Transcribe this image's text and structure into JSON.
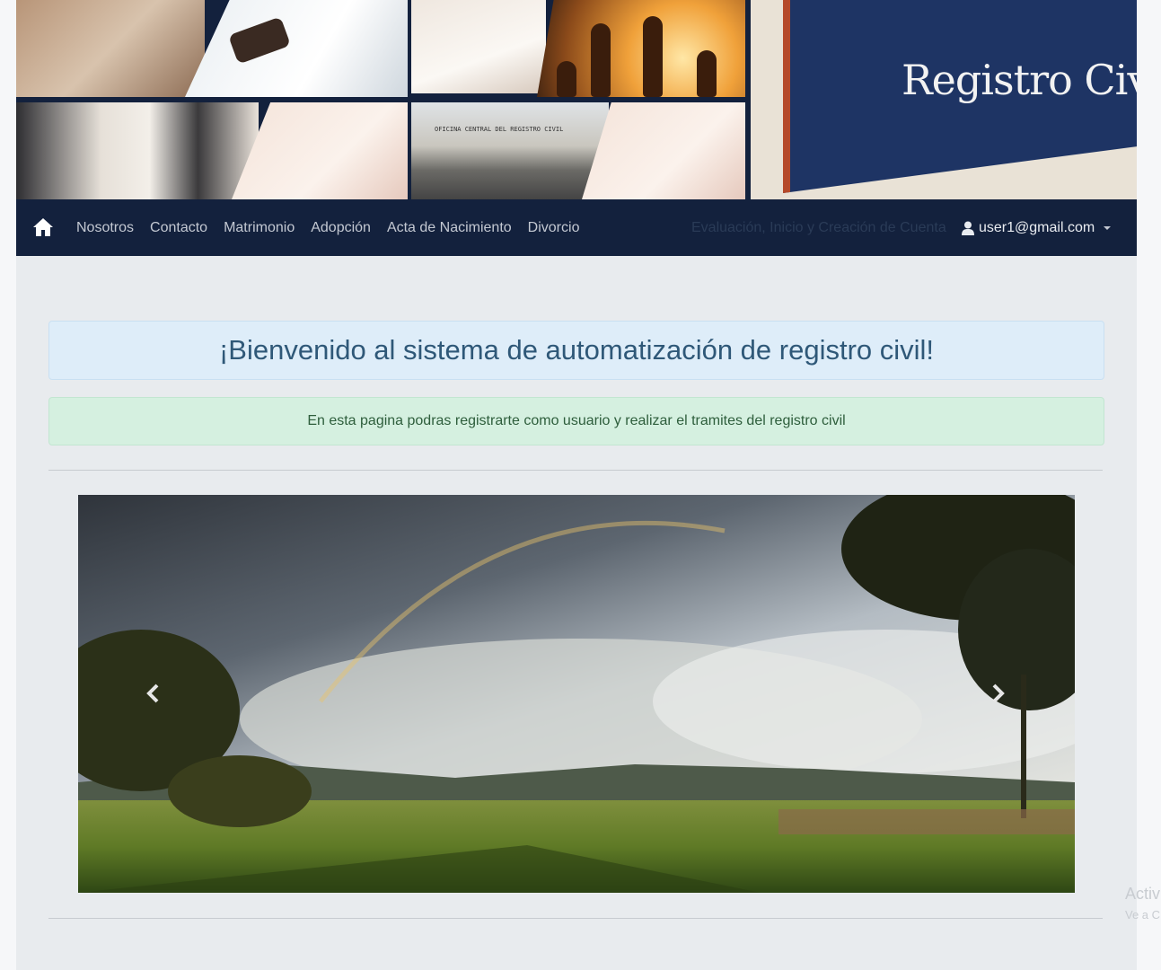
{
  "banner": {
    "sign_text": "Registro Civil",
    "building_sign_text": "OFICINA CENTRAL DEL REGISTRO CIVIL"
  },
  "navbar": {
    "home_icon": "home-icon",
    "links": [
      {
        "label": "Nosotros"
      },
      {
        "label": "Contacto"
      },
      {
        "label": "Matrimonio"
      },
      {
        "label": "Adopción"
      },
      {
        "label": "Acta de Nacimiento"
      },
      {
        "label": "Divorcio"
      }
    ],
    "faded_text": "Evaluación, Inicio y Creación de Cuenta",
    "user_icon": "user-icon",
    "user_email": "user1@gmail.com",
    "dropdown_icon": "caret-down-icon",
    "bg_color": "#13213d"
  },
  "main": {
    "welcome_title": "¡Bienvenido al sistema de automatización de registro civil!",
    "info_text": "En esta pagina podras registrarte como usuario y realizar el tramites del registro civil"
  },
  "carousel": {
    "prev_icon": "chevron-left-icon",
    "next_icon": "chevron-right-icon"
  },
  "watermark": {
    "line1": "Activ",
    "line2": "Ve a C"
  }
}
